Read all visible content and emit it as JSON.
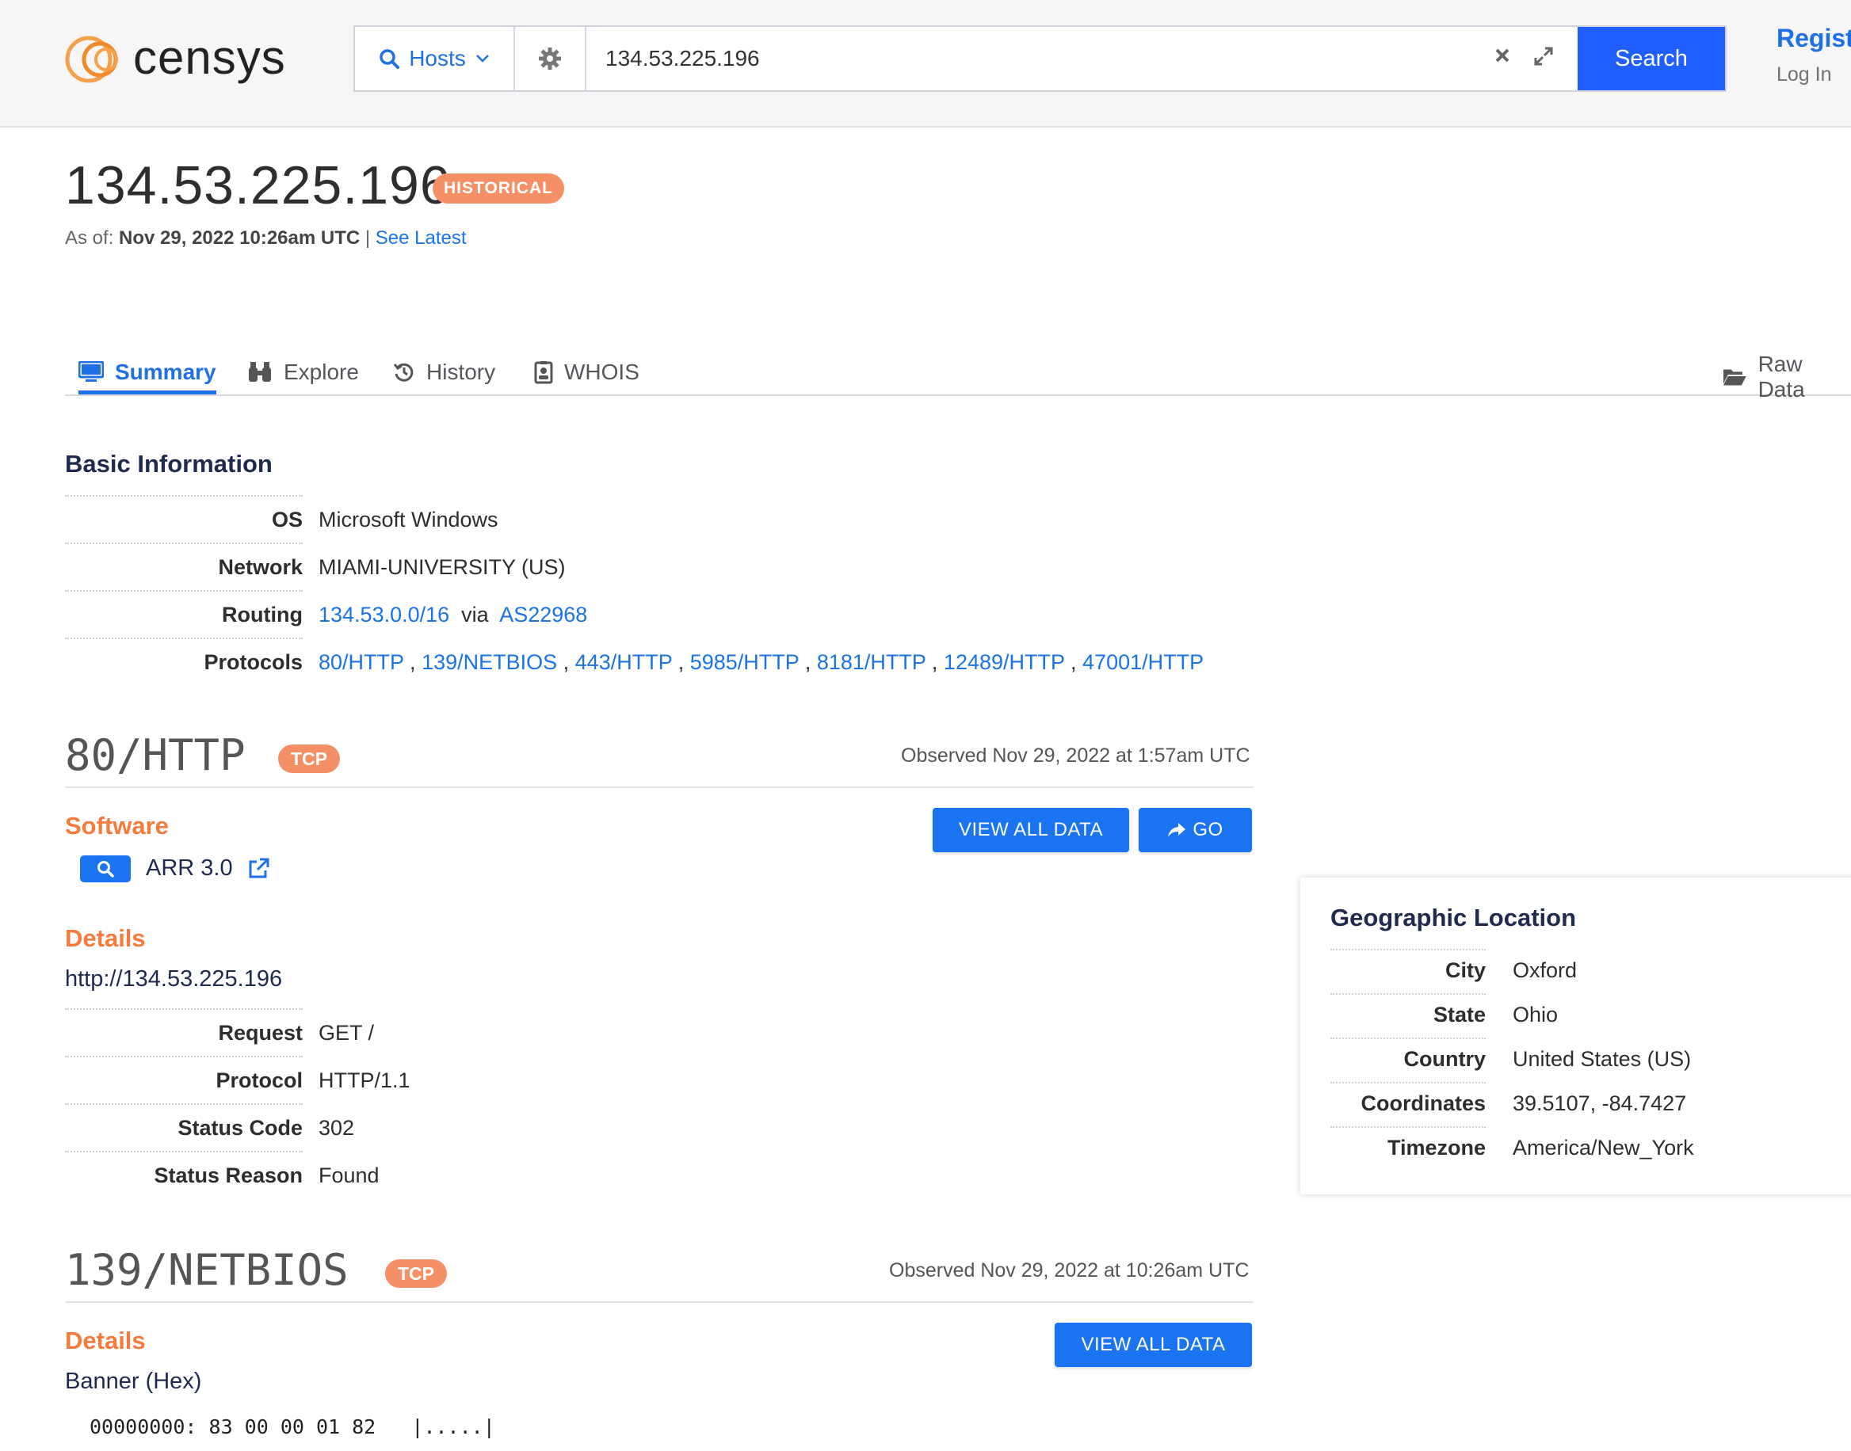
{
  "header": {
    "logo_text": "censys",
    "search_type": "Hosts",
    "query": "134.53.225.196",
    "search_label": "Search",
    "register_label": "Register",
    "login_label": "Log In",
    "accent": "#1f5fff"
  },
  "host": {
    "ip": "134.53.225.196",
    "badge": "HISTORICAL",
    "asof_prefix": "As of:",
    "asof_date": "Nov 29, 2022 10:26am UTC",
    "separator": "|",
    "see_latest": "See Latest"
  },
  "tabs": [
    {
      "label": "Summary",
      "icon": "monitor-icon"
    },
    {
      "label": "Explore",
      "icon": "binoculars-icon"
    },
    {
      "label": "History",
      "icon": "history-icon"
    },
    {
      "label": "WHOIS",
      "icon": "id-card-icon"
    }
  ],
  "raw_data_label": "Raw Data",
  "basic": {
    "title": "Basic Information",
    "os_label": "OS",
    "os_value": "Microsoft Windows",
    "network_label": "Network",
    "network_value": "MIAMI-UNIVERSITY (US)",
    "routing_label": "Routing",
    "routing_prefix": "134.53.0.0/16",
    "routing_via": "via",
    "routing_as": "AS22968",
    "protocols_label": "Protocols",
    "protocols": [
      "80/HTTP",
      "139/NETBIOS",
      "443/HTTP",
      "5985/HTTP",
      "8181/HTTP",
      "12489/HTTP",
      "47001/HTTP"
    ]
  },
  "svc80": {
    "title": "80/HTTP",
    "transport": "TCP",
    "observed": "Observed Nov 29, 2022 at 1:57am UTC",
    "software_heading": "Software",
    "software_name": "ARR 3.0",
    "view_all": "VIEW ALL DATA",
    "go": "GO",
    "details_heading": "Details",
    "url": "http://134.53.225.196",
    "request_label": "Request",
    "request_value": "GET /",
    "protocol_label": "Protocol",
    "protocol_value": "HTTP/1.1",
    "status_code_label": "Status Code",
    "status_code_value": "302",
    "status_reason_label": "Status Reason",
    "status_reason_value": "Found"
  },
  "geo": {
    "title": "Geographic Location",
    "city_label": "City",
    "city": "Oxford",
    "state_label": "State",
    "state": "Ohio",
    "country_label": "Country",
    "country": "United States (US)",
    "coords_label": "Coordinates",
    "coords": "39.5107, -84.7427",
    "tz_label": "Timezone",
    "tz": "America/New_York"
  },
  "svc139": {
    "title": "139/NETBIOS",
    "transport": "TCP",
    "observed": "Observed Nov 29, 2022 at 10:26am UTC",
    "details_heading": "Details",
    "view_all": "VIEW ALL DATA",
    "banner_heading": "Banner (Hex)",
    "banner_line": "00000000: 83 00 00 01 82",
    "banner_ascii": "|.....|"
  }
}
